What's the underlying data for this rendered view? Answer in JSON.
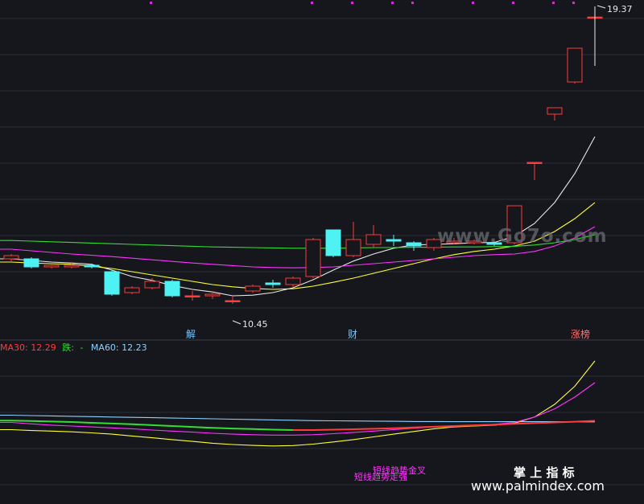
{
  "chart_data": {
    "type": "candlestick",
    "annotations": {
      "high_label": "19.37",
      "low_label": "10.45",
      "event_1": "解",
      "event_2": "财",
      "event_3": "涨榜"
    },
    "ylim_main": [
      9.9,
      19.7
    ],
    "candles": [
      {
        "o": 11.85,
        "c": 11.95,
        "h": 12.0,
        "l": 11.75,
        "dir": "up"
      },
      {
        "o": 11.85,
        "c": 11.6,
        "h": 11.9,
        "l": 11.55,
        "dir": "down"
      },
      {
        "o": 11.6,
        "c": 11.65,
        "h": 11.7,
        "l": 11.55,
        "dir": "up"
      },
      {
        "o": 11.65,
        "c": 11.6,
        "h": 11.75,
        "l": 11.55,
        "dir": "up"
      },
      {
        "o": 11.65,
        "c": 11.6,
        "h": 11.7,
        "l": 11.55,
        "dir": "down"
      },
      {
        "o": 11.45,
        "c": 10.75,
        "h": 11.5,
        "l": 10.7,
        "dir": "down"
      },
      {
        "o": 10.8,
        "c": 10.95,
        "h": 11.0,
        "l": 10.75,
        "dir": "up"
      },
      {
        "o": 10.95,
        "c": 11.15,
        "h": 11.25,
        "l": 10.9,
        "dir": "up"
      },
      {
        "o": 11.15,
        "c": 10.7,
        "h": 11.2,
        "l": 10.65,
        "dir": "down"
      },
      {
        "o": 10.7,
        "c": 10.7,
        "h": 10.85,
        "l": 10.55,
        "dir": "up"
      },
      {
        "o": 10.75,
        "c": 10.7,
        "h": 10.85,
        "l": 10.6,
        "dir": "up"
      },
      {
        "o": 10.55,
        "c": 10.55,
        "h": 10.7,
        "l": 10.45,
        "dir": "up"
      },
      {
        "o": 10.85,
        "c": 11.0,
        "h": 11.05,
        "l": 10.8,
        "dir": "up"
      },
      {
        "o": 11.05,
        "c": 11.1,
        "h": 11.2,
        "l": 10.95,
        "dir": "down"
      },
      {
        "o": 11.05,
        "c": 11.25,
        "h": 11.3,
        "l": 10.95,
        "dir": "up"
      },
      {
        "o": 11.3,
        "c": 12.45,
        "h": 12.5,
        "l": 11.25,
        "dir": "up"
      },
      {
        "o": 11.95,
        "c": 12.75,
        "h": 12.75,
        "l": 11.9,
        "dir": "down"
      },
      {
        "o": 11.95,
        "c": 12.45,
        "h": 13.0,
        "l": 11.9,
        "dir": "up"
      },
      {
        "o": 12.3,
        "c": 12.6,
        "h": 12.9,
        "l": 12.2,
        "dir": "up"
      },
      {
        "o": 12.45,
        "c": 12.4,
        "h": 12.6,
        "l": 12.25,
        "dir": "down"
      },
      {
        "o": 12.35,
        "c": 12.25,
        "h": 12.4,
        "l": 12.1,
        "dir": "down"
      },
      {
        "o": 12.2,
        "c": 12.45,
        "h": 12.5,
        "l": 12.1,
        "dir": "up"
      },
      {
        "o": 12.35,
        "c": 12.4,
        "h": 12.5,
        "l": 12.3,
        "dir": "up"
      },
      {
        "o": 12.4,
        "c": 12.35,
        "h": 12.45,
        "l": 12.3,
        "dir": "up"
      },
      {
        "o": 12.3,
        "c": 12.35,
        "h": 12.4,
        "l": 12.25,
        "dir": "down"
      },
      {
        "o": 12.35,
        "c": 13.5,
        "h": 13.5,
        "l": 12.3,
        "dir": "up"
      },
      {
        "o": 14.85,
        "c": 14.85,
        "h": 14.85,
        "l": 14.3,
        "dir": "up"
      },
      {
        "o": 16.35,
        "c": 16.55,
        "h": 16.55,
        "l": 16.15,
        "dir": "up"
      },
      {
        "o": 17.35,
        "c": 18.4,
        "h": 18.4,
        "l": 17.3,
        "dir": "up"
      },
      {
        "o": 19.37,
        "c": 19.37,
        "h": 19.37,
        "l": 18.55,
        "dir": "up"
      }
    ],
    "ma_lines": [
      {
        "color": "#e8e8e8",
        "values": [
          11.85,
          11.8,
          11.75,
          11.72,
          11.68,
          11.5,
          11.3,
          11.18,
          11.02,
          10.9,
          10.82,
          10.7,
          10.72,
          10.8,
          10.95,
          11.2,
          11.5,
          11.78,
          12.0,
          12.18,
          12.28,
          12.3,
          12.32,
          12.35,
          12.36,
          12.55,
          12.95,
          13.6,
          14.5,
          15.65
        ]
      },
      {
        "color": "#ffff33",
        "values": [
          11.75,
          11.72,
          11.7,
          11.68,
          11.62,
          11.55,
          11.45,
          11.35,
          11.25,
          11.15,
          11.05,
          10.98,
          10.93,
          10.9,
          10.92,
          11.0,
          11.12,
          11.25,
          11.4,
          11.55,
          11.7,
          11.85,
          11.98,
          12.08,
          12.15,
          12.25,
          12.4,
          12.7,
          13.1,
          13.6
        ]
      },
      {
        "color": "#ff33ff",
        "values": [
          12.15,
          12.1,
          12.05,
          12.0,
          11.96,
          11.92,
          11.87,
          11.82,
          11.77,
          11.72,
          11.68,
          11.64,
          11.6,
          11.58,
          11.57,
          11.58,
          11.6,
          11.65,
          11.7,
          11.75,
          11.8,
          11.85,
          11.9,
          11.95,
          11.98,
          12.0,
          12.08,
          12.25,
          12.5,
          12.85
        ]
      },
      {
        "color": "#33dd33",
        "values": [
          12.42,
          12.4,
          12.38,
          12.36,
          12.34,
          12.32,
          12.3,
          12.28,
          12.26,
          12.24,
          12.22,
          12.21,
          12.2,
          12.19,
          12.18,
          12.18,
          12.18,
          12.19,
          12.2,
          12.2,
          12.21,
          12.21,
          12.22,
          12.22,
          12.23,
          12.24,
          12.28,
          12.35,
          12.45,
          12.6
        ]
      }
    ],
    "sub_panel": {
      "legend": [
        {
          "text": "MA30: 12.29",
          "color": "#ff3b3b"
        },
        {
          "text": "跌:",
          "color": "#33dd33"
        },
        {
          "text": "-",
          "color": "#33dd33"
        },
        {
          "text": "MA60: 12.23",
          "color": "#8fd0ff"
        }
      ],
      "ylim": [
        8.0,
        16.0
      ],
      "bands": [
        {
          "color": "#ffff33",
          "values": [
            11.8,
            11.75,
            11.72,
            11.68,
            11.62,
            11.55,
            11.45,
            11.35,
            11.25,
            11.15,
            11.05,
            10.98,
            10.93,
            10.9,
            10.92,
            11.0,
            11.12,
            11.25,
            11.4,
            11.55,
            11.7,
            11.85,
            11.95,
            12.0,
            12.05,
            12.15,
            12.5,
            13.2,
            14.2,
            15.6
          ]
        },
        {
          "color": "#ff33ff",
          "values": [
            12.2,
            12.12,
            12.05,
            12.0,
            11.95,
            11.9,
            11.85,
            11.78,
            11.72,
            11.66,
            11.6,
            11.55,
            11.52,
            11.5,
            11.5,
            11.52,
            11.58,
            11.65,
            11.72,
            11.8,
            11.88,
            11.95,
            12.0,
            12.05,
            12.1,
            12.2,
            12.5,
            12.95,
            13.6,
            14.4
          ]
        }
      ],
      "ma30_segments": [
        {
          "color": "#33dd33",
          "from": 0,
          "to": 14,
          "values": [
            12.3,
            12.28,
            12.25,
            12.22,
            12.18,
            12.14,
            12.1,
            12.05,
            12.0,
            11.95,
            11.9,
            11.86,
            11.83,
            11.8,
            11.78
          ]
        },
        {
          "color": "#ff3b3b",
          "from": 14,
          "to": 29,
          "values": [
            11.78,
            11.78,
            11.8,
            11.82,
            11.85,
            11.88,
            11.92,
            11.96,
            12.0,
            12.04,
            12.08,
            12.12,
            12.16,
            12.2,
            12.24,
            12.29
          ]
        }
      ],
      "ma60": {
        "color": "#8fd0ff",
        "values": [
          12.6,
          12.58,
          12.56,
          12.54,
          12.52,
          12.5,
          12.48,
          12.46,
          12.44,
          12.42,
          12.4,
          12.38,
          12.36,
          12.34,
          12.32,
          12.3,
          12.29,
          12.28,
          12.27,
          12.26,
          12.25,
          12.25,
          12.24,
          12.24,
          12.24,
          12.24,
          12.24,
          12.24,
          12.23,
          12.23
        ]
      },
      "overlay_texts": [
        "短线趋势金叉",
        "短线趋势走强"
      ]
    }
  },
  "watermark": {
    "center": "www.Go7o.com",
    "brand": "掌 上 指 标",
    "site": "www.palmindex.com"
  },
  "colors": {
    "background": "#16171c",
    "grid": "#2a2c36",
    "up": "#ff3b3b",
    "down": "#4ef2f2",
    "annotation": "#e8e8e8",
    "marker": "#cc33cc"
  }
}
